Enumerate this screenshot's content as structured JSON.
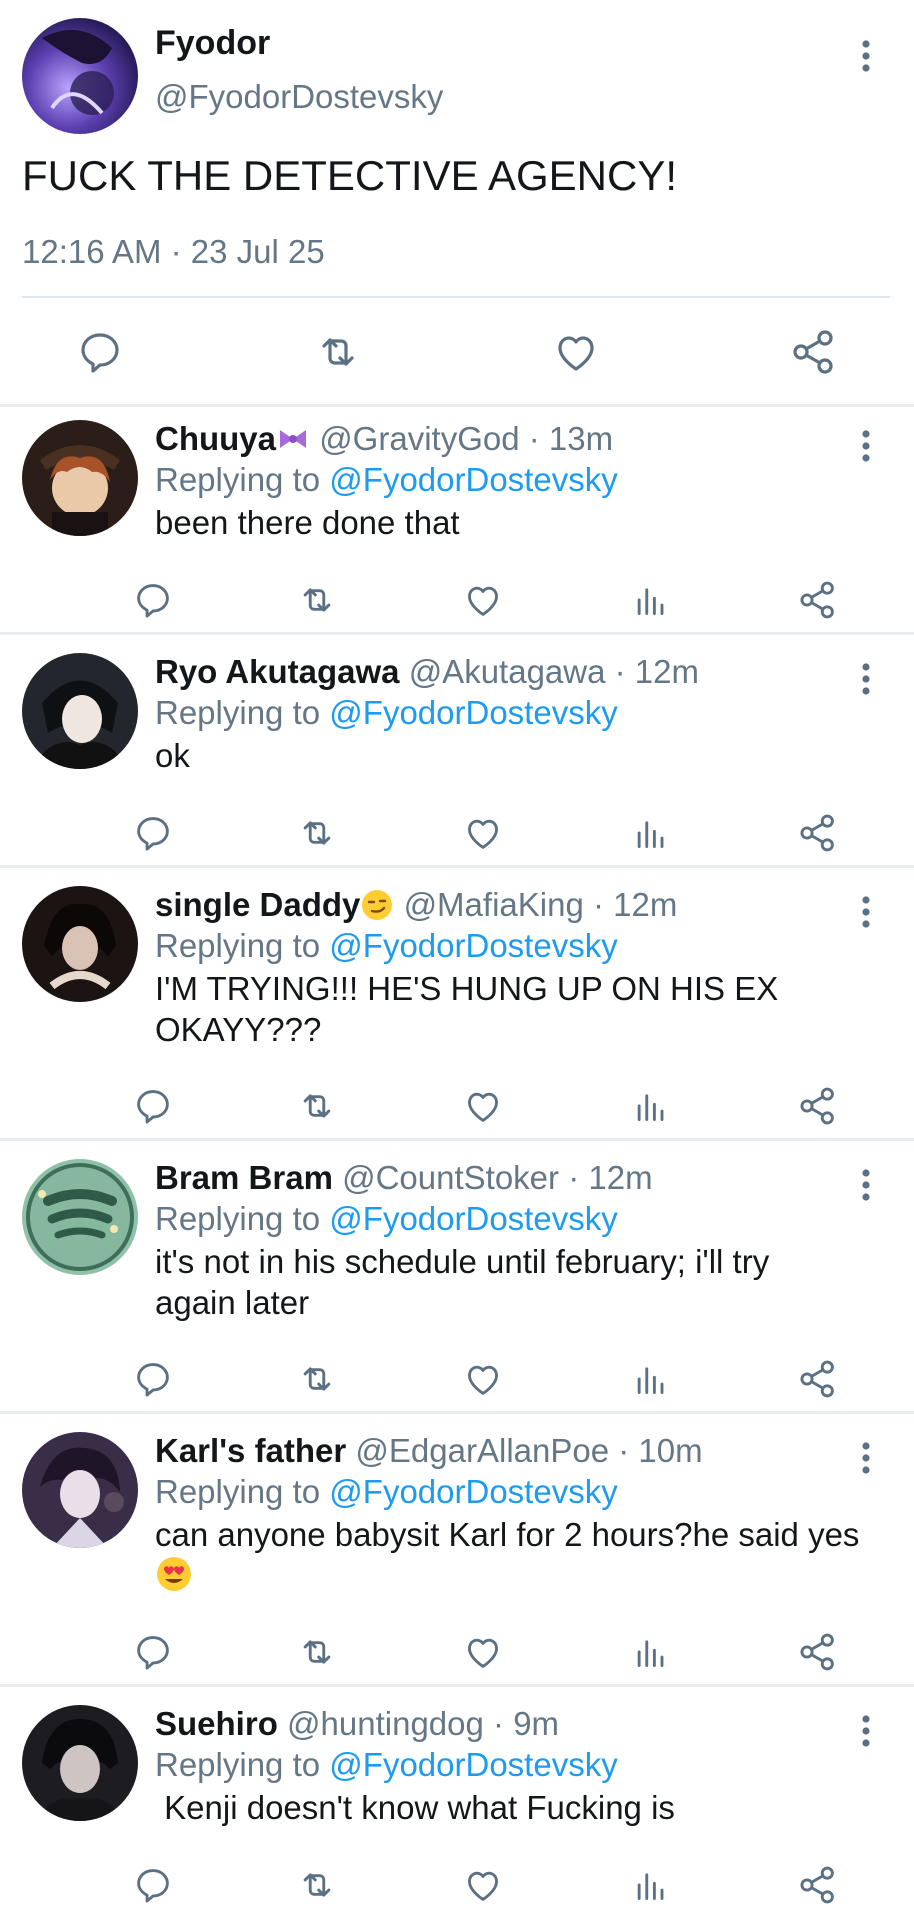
{
  "main": {
    "name": "Fyodor",
    "handle": "@FyodorDostevsky",
    "text": "FUCK THE DETECTIVE AGENCY!",
    "timestamp": "12:16 AM · 23 Jul 25",
    "avatar_color": "#4a3a8c",
    "actions": [
      "reply-icon",
      "retweet-icon",
      "like-icon",
      "share-icon"
    ]
  },
  "colors": {
    "accent": "#1d9bf0",
    "muted": "#657786",
    "text": "#14171a",
    "icon": "#5b7083",
    "divider": "#e6ecf0"
  },
  "replies": [
    {
      "name": "Chuuya",
      "name_emoji": "🎀",
      "handle": "@GravityGod",
      "time": "13m",
      "replying_label": "Replying to",
      "replying_to": "@FyodorDostevsky",
      "text": "been there done that",
      "avatar_color": "#3b2a22"
    },
    {
      "name": "Ryo Akutagawa",
      "handle": "@Akutagawa",
      "time": "12m",
      "replying_label": "Replying to",
      "replying_to": "@FyodorDostevsky",
      "text": "ok",
      "avatar_color": "#1f2328"
    },
    {
      "name": "single Daddy",
      "name_emoji": "😏",
      "handle": "@MafiaKing",
      "time": "12m",
      "replying_label": "Replying to",
      "replying_to": "@FyodorDostevsky",
      "text_lines": [
        "I'M TRYING!!! HE'S HUNG UP ON HIS EX",
        "OKAYY???"
      ],
      "avatar_color": "#2a1e1a"
    },
    {
      "name": "Bram Bram",
      "handle": "@CountStoker",
      "time": "12m",
      "replying_label": "Replying to",
      "replying_to": "@FyodorDostevsky",
      "text_lines": [
        "it's not in his schedule until february; i'll try",
        "again later"
      ],
      "avatar_color": "#7fb09a"
    },
    {
      "name": "Karl's father",
      "handle": "@EdgarAllanPoe",
      "time": "10m",
      "replying_label": "Replying to",
      "replying_to": "@FyodorDostevsky",
      "text_lines": [
        "can anyone babysit Karl for 2 hours?he said yes"
      ],
      "trailing_emoji": "😍",
      "avatar_color": "#3a2a45"
    },
    {
      "name": "Suehiro",
      "handle": "@huntingdog",
      "time": "9m",
      "replying_label": "Replying to",
      "replying_to": "@FyodorDostevsky",
      "text": " Kenji doesn't know what Fucking is",
      "avatar_color": "#222024"
    }
  ],
  "reply_actions": [
    "reply-icon",
    "retweet-icon",
    "like-icon",
    "views-icon",
    "share-icon"
  ]
}
